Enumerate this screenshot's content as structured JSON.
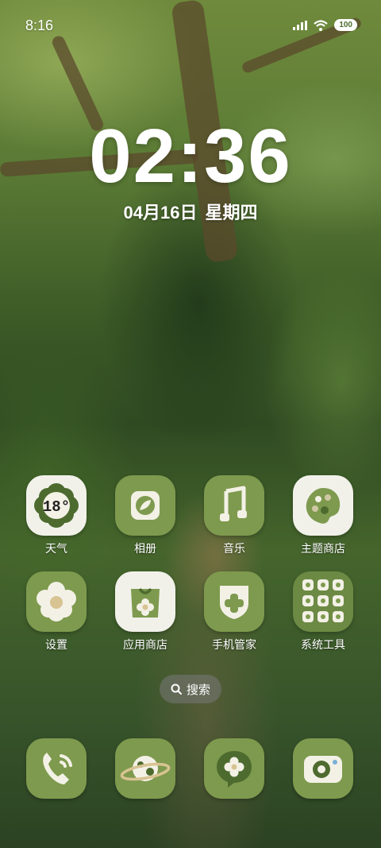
{
  "status_bar": {
    "time": "8:16",
    "battery": "100",
    "icons": [
      "signal-icon",
      "wifi-icon",
      "battery-icon"
    ]
  },
  "clock": {
    "time": "02:36",
    "date": "04月16日",
    "weekday": "星期四"
  },
  "apps": [
    {
      "label": "天气",
      "icon": "weather-icon",
      "badge": "18°"
    },
    {
      "label": "相册",
      "icon": "gallery-icon"
    },
    {
      "label": "音乐",
      "icon": "music-icon"
    },
    {
      "label": "主题商店",
      "icon": "theme-store-icon"
    },
    {
      "label": "设置",
      "icon": "settings-icon"
    },
    {
      "label": "应用商店",
      "icon": "app-store-icon"
    },
    {
      "label": "手机管家",
      "icon": "security-icon"
    },
    {
      "label": "系统工具",
      "icon": "system-tools-folder-icon"
    }
  ],
  "search": {
    "label": "搜索",
    "icon": "search-icon"
  },
  "dock": [
    {
      "icon": "phone-icon"
    },
    {
      "icon": "browser-planet-icon"
    },
    {
      "icon": "messages-icon"
    },
    {
      "icon": "camera-icon"
    }
  ],
  "colors": {
    "icon_green": "#7e9a4e",
    "icon_light": "#f1f1ea",
    "accent_dark_green": "#4d6b2e"
  }
}
